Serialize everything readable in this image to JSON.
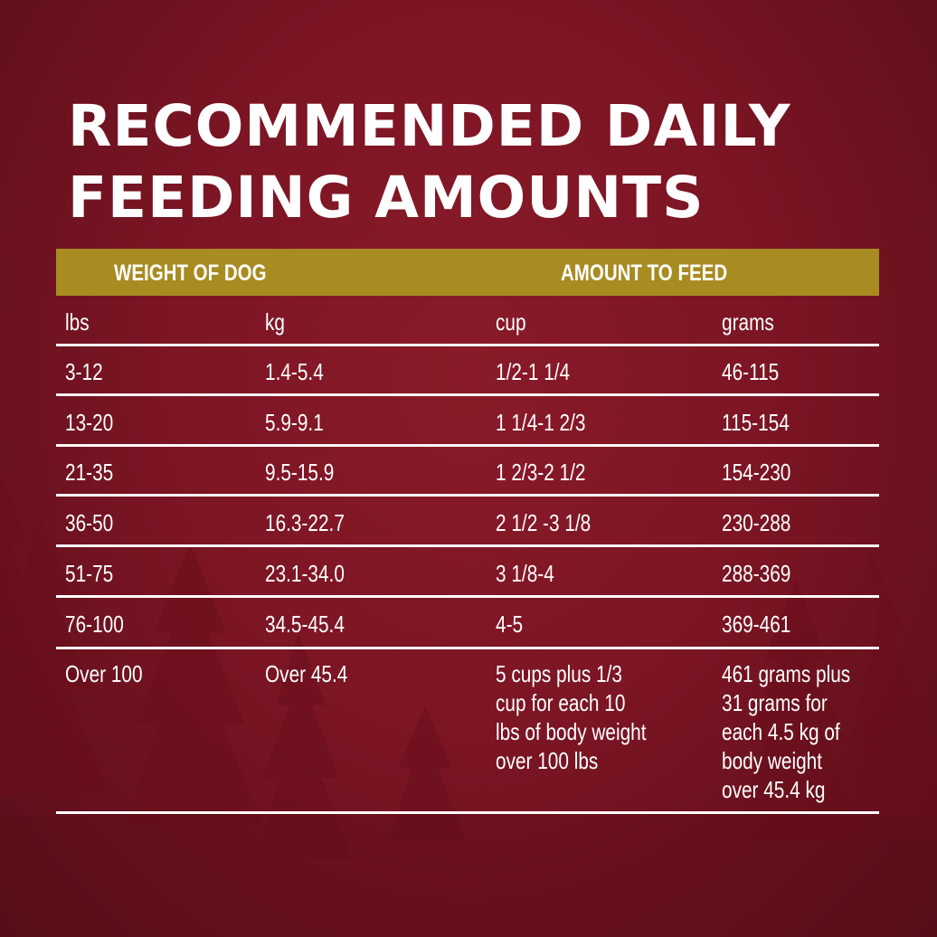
{
  "title": {
    "line1": "RECOMMENDED DAILY",
    "line2": "FEEDING AMOUNTS"
  },
  "header": {
    "weight_label": "WEIGHT OF DOG",
    "amount_label": "AMOUNT TO FEED"
  },
  "columns": [
    "lbs",
    "kg",
    "cup",
    "grams"
  ],
  "rows": [
    [
      "3-12",
      "1.4-5.4",
      "1/2-1 1/4",
      "46-115"
    ],
    [
      "13-20",
      "5.9-9.1",
      "1 1/4-1 2/3",
      "115-154"
    ],
    [
      "21-35",
      "9.5-15.9",
      "1 2/3-2 1/2",
      "154-230"
    ],
    [
      "36-50",
      "16.3-22.7",
      "2 1/2 -3 1/8",
      "230-288"
    ],
    [
      "51-75",
      "23.1-34.0",
      "3 1/8-4",
      "288-369"
    ],
    [
      "76-100",
      "34.5-45.4",
      "4-5",
      "369-461"
    ],
    [
      "Over 100",
      "Over 45.4",
      "5 cups plus 1/3\ncup for each 10\nlbs of body weight\nover 100 lbs",
      "461 grams plus\n31 grams for\neach 4.5 kg of\nbody weight\nover 45.4 kg"
    ]
  ],
  "colors": {
    "background": "#7c1524",
    "header_bar": "#a88b21",
    "text": "#ffffff"
  }
}
